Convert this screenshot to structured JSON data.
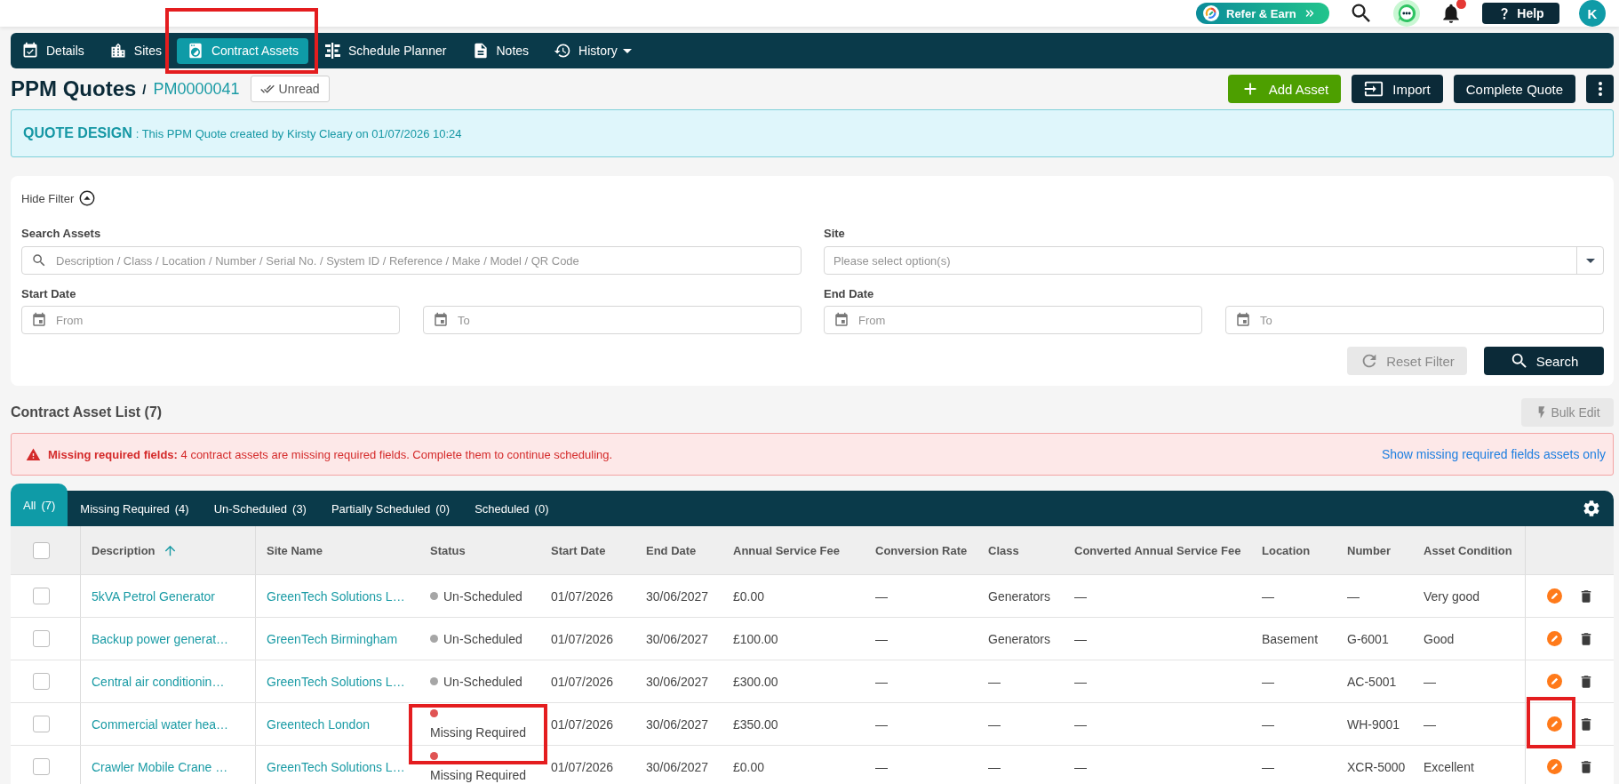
{
  "top_bar": {
    "refer_button": "Refer & Earn",
    "has_notifications": true,
    "help_button": "Help",
    "avatar_initial": "K"
  },
  "nav_tabs": [
    {
      "label": "Details",
      "selected": false,
      "dropdown": false,
      "highlighted": false
    },
    {
      "label": "Sites",
      "selected": false,
      "dropdown": false,
      "highlighted": false
    },
    {
      "label": "Contract Assets",
      "selected": true,
      "dropdown": false,
      "highlighted": true
    },
    {
      "label": "Schedule Planner",
      "selected": false,
      "dropdown": false,
      "highlighted": false
    },
    {
      "label": "Notes",
      "selected": false,
      "dropdown": false,
      "highlighted": false
    },
    {
      "label": "History",
      "selected": false,
      "dropdown": true,
      "highlighted": false
    }
  ],
  "header": {
    "title": "PPM Quotes",
    "separator": "/",
    "reference": "PM0000041",
    "unread_button": "Unread",
    "actions": [
      {
        "kind": "add",
        "label": "Add Asset"
      },
      {
        "kind": "import",
        "label": "Import"
      },
      {
        "kind": "plain",
        "label": "Complete Quote"
      }
    ]
  },
  "quote_banner": {
    "heading": "QUOTE DESIGN",
    "text": ": This PPM Quote created by Kirsty Cleary on 01/07/2026 10:24"
  },
  "filter": {
    "toggle_label": "Hide Filter",
    "expanded": true,
    "search": {
      "label": "Search Assets",
      "placeholder": "Description / Class / Location / Number / Serial No. / System ID / Reference / Make / Model / QR Code"
    },
    "site": {
      "label": "Site",
      "placeholder": "Please select option(s)"
    },
    "start_date": {
      "label": "Start Date",
      "from_placeholder": "From",
      "to_placeholder": "To"
    },
    "end_date": {
      "label": "End Date",
      "from_placeholder": "From",
      "to_placeholder": "To"
    },
    "reset_button": {
      "label": "Reset Filter",
      "disabled": true
    },
    "search_button": {
      "label": "Search"
    }
  },
  "asset_list": {
    "title": "Contract Asset List (7)",
    "bulk_edit_button": {
      "label": "Bulk Edit",
      "disabled": true
    }
  },
  "alert": {
    "message": "**Missing required fields:** 4 contract assets are missing required fields. Complete them to continue scheduling.",
    "link": "Show missing required fields assets only"
  },
  "status_tabs": [
    {
      "label": "All",
      "count": "(7)",
      "selected": true
    },
    {
      "label": "Missing Required",
      "count": "(4)",
      "selected": false
    },
    {
      "label": "Un-Scheduled",
      "count": "(3)",
      "selected": false
    },
    {
      "label": "Partially Scheduled",
      "count": "(0)",
      "selected": false
    },
    {
      "label": "Scheduled",
      "count": "(0)",
      "selected": false
    }
  ],
  "table": {
    "select_all_checked": false,
    "columns": [
      {
        "label": "Description",
        "sorted": true
      },
      {
        "label": "Site Name",
        "sorted": false
      },
      {
        "label": "Status",
        "sorted": false
      },
      {
        "label": "Start Date",
        "sorted": false
      },
      {
        "label": "End Date",
        "sorted": false
      },
      {
        "label": "Annual Service Fee",
        "sorted": false
      },
      {
        "label": "Conversion Rate",
        "sorted": false
      },
      {
        "label": "Class",
        "sorted": false
      },
      {
        "label": "Converted Annual Service Fee",
        "sorted": false
      },
      {
        "label": "Location",
        "sorted": false
      },
      {
        "label": "Number",
        "sorted": false
      },
      {
        "label": "Asset Condition",
        "sorted": false
      }
    ],
    "rows": [
      {
        "checked": false,
        "description": "5kVA Petrol Generator",
        "site_name": "GreenTech Solutions L…",
        "status": {
          "label": "Un-Scheduled",
          "color": "#a6a6a6",
          "highlighted": false
        },
        "start_date": "01/07/2026",
        "end_date": "30/06/2027",
        "annual_service_fee": "£0.00",
        "conversion_rate": "—",
        "class": "Generators",
        "converted_annual_service_fee": "—",
        "location": "—",
        "number": "—",
        "asset_condition": "Very good",
        "edit_highlighted": false
      },
      {
        "checked": false,
        "description": "Backup power generat…",
        "site_name": "GreenTech Birmingham",
        "status": {
          "label": "Un-Scheduled",
          "color": "#a6a6a6",
          "highlighted": false
        },
        "start_date": "01/07/2026",
        "end_date": "30/06/2027",
        "annual_service_fee": "£100.00",
        "conversion_rate": "—",
        "class": "Generators",
        "converted_annual_service_fee": "—",
        "location": "Basement",
        "number": "G-6001",
        "asset_condition": "Good",
        "edit_highlighted": false
      },
      {
        "checked": false,
        "description": "Central air conditionin…",
        "site_name": "GreenTech Solutions L…",
        "status": {
          "label": "Un-Scheduled",
          "color": "#a6a6a6",
          "highlighted": false
        },
        "start_date": "01/07/2026",
        "end_date": "30/06/2027",
        "annual_service_fee": "£300.00",
        "conversion_rate": "—",
        "class": "—",
        "converted_annual_service_fee": "—",
        "location": "—",
        "number": "AC-5001",
        "asset_condition": "—",
        "edit_highlighted": false
      },
      {
        "checked": false,
        "description": "Commercial water hea…",
        "site_name": "Greentech London",
        "status": {
          "label": "Missing Required",
          "color": "#e05454",
          "highlighted": true
        },
        "start_date": "01/07/2026",
        "end_date": "30/06/2027",
        "annual_service_fee": "£350.00",
        "conversion_rate": "—",
        "class": "—",
        "converted_annual_service_fee": "—",
        "location": "—",
        "number": "WH-9001",
        "asset_condition": "—",
        "edit_highlighted": true
      },
      {
        "checked": false,
        "description": "Crawler Mobile Crane …",
        "site_name": "GreenTech Solutions L…",
        "status": {
          "label": "Missing Required",
          "color": "#e05454",
          "highlighted": false
        },
        "start_date": "01/07/2026",
        "end_date": "30/06/2027",
        "annual_service_fee": "£0.00",
        "conversion_rate": "—",
        "class": "—",
        "converted_annual_service_fee": "—",
        "location": "—",
        "number": "XCR-5000",
        "asset_condition": "Excellent",
        "edit_highlighted": false
      }
    ]
  }
}
